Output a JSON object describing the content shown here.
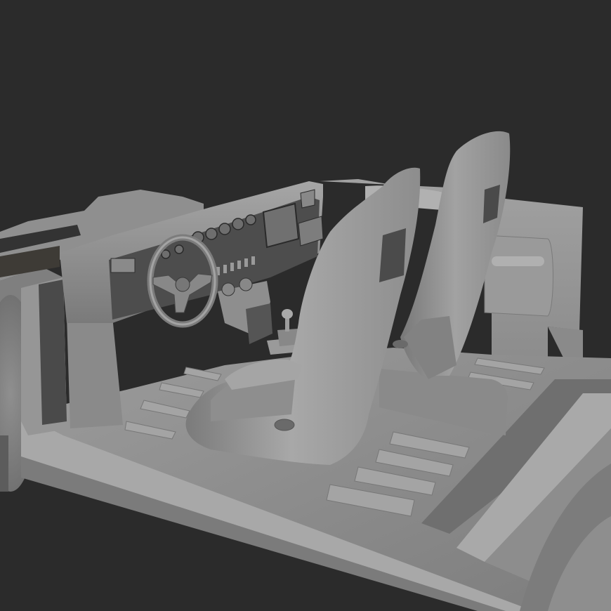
{
  "viewport": {
    "background": "#2b2b2b"
  },
  "model": {
    "material_base": "#8a8a8a",
    "material_light": "#a3a3a3",
    "material_shadow": "#5a5a5a",
    "parts": [
      "chassis",
      "floor-pan",
      "dashboard",
      "steering-wheel",
      "gear-shifter",
      "center-console",
      "seat-left",
      "seat-right",
      "rear-bulkhead",
      "wheel-arch-left",
      "wheel-arch-right"
    ]
  }
}
